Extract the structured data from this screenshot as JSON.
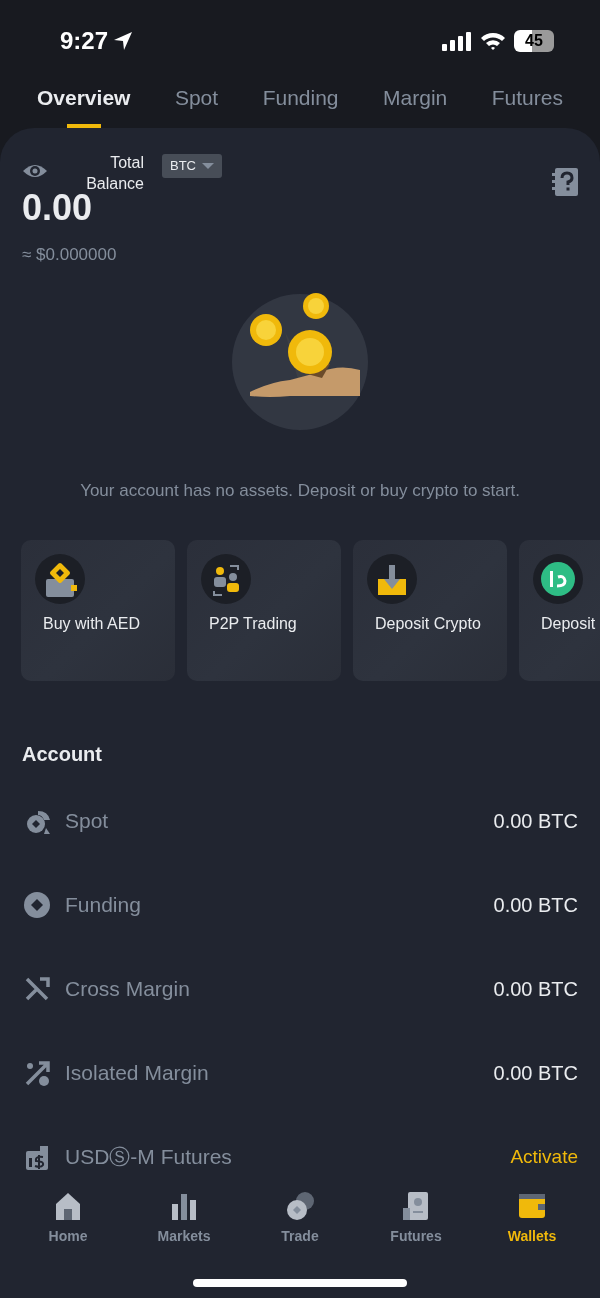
{
  "status_bar": {
    "time": "9:27",
    "battery": "45"
  },
  "tabs": [
    {
      "label": "Overview",
      "selected": true
    },
    {
      "label": "Spot",
      "selected": false
    },
    {
      "label": "Funding",
      "selected": false
    },
    {
      "label": "Margin",
      "selected": false
    },
    {
      "label": "Futures",
      "selected": false
    }
  ],
  "balance": {
    "label": "Total Balance",
    "currency": "BTC",
    "amount": "0.00",
    "fiat": "≈ $0.000000"
  },
  "empty_message": "Your account has no assets. Deposit or buy crypto to start.",
  "actions": [
    {
      "label": "Buy with AED"
    },
    {
      "label": "P2P Trading"
    },
    {
      "label": "Deposit Crypto"
    },
    {
      "label": "Deposit"
    }
  ],
  "account": {
    "title": "Account",
    "rows": [
      {
        "label": "Spot",
        "value": "0.00 BTC",
        "kind": "balance"
      },
      {
        "label": "Funding",
        "value": "0.00 BTC",
        "kind": "balance"
      },
      {
        "label": "Cross Margin",
        "value": "0.00 BTC",
        "kind": "balance"
      },
      {
        "label": "Isolated Margin",
        "value": "0.00 BTC",
        "kind": "balance"
      },
      {
        "label": "USDⓈ-M Futures",
        "value": "Activate",
        "kind": "action"
      }
    ]
  },
  "bottom_nav": [
    {
      "label": "Home",
      "selected": false
    },
    {
      "label": "Markets",
      "selected": false
    },
    {
      "label": "Trade",
      "selected": false
    },
    {
      "label": "Futures",
      "selected": false
    },
    {
      "label": "Wallets",
      "selected": true
    }
  ]
}
